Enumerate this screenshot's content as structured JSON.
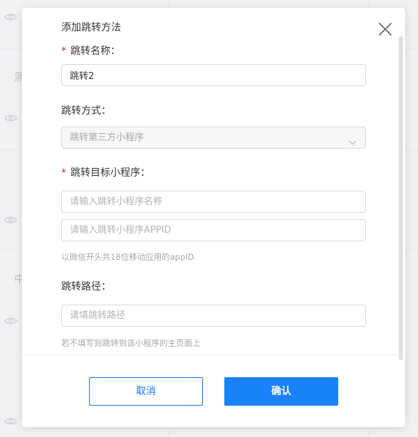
{
  "background": {
    "side_chars": [
      "测",
      "中"
    ]
  },
  "dialog": {
    "title": "添加跳转方法",
    "close_icon": "close-icon",
    "fields": {
      "name": {
        "required_mark": "*",
        "label": "跳转名称：",
        "value": "跳转2"
      },
      "method": {
        "label": "跳转方式：",
        "selected": "跳转第三方小程序",
        "disabled": true,
        "icon": "chevron-down-icon"
      },
      "target": {
        "required_mark": "*",
        "label": "跳转目标小程序：",
        "name_placeholder": "请输入跳转小程序名称",
        "appid_placeholder": "请输入跳转小程序APPID",
        "hint": "以微信开头共18位移动应用的appID"
      },
      "path": {
        "label": "跳转路径：",
        "placeholder": "请填跳转路径",
        "hint": "若不填写则跳转到该小程序的主页面上"
      }
    },
    "footer": {
      "cancel_label": "取消",
      "ok_label": "确认"
    }
  },
  "colors": {
    "primary": "#1a82f8",
    "required": "#f5222d",
    "hint": "#a6a6a6",
    "border": "#d9d9d9"
  }
}
